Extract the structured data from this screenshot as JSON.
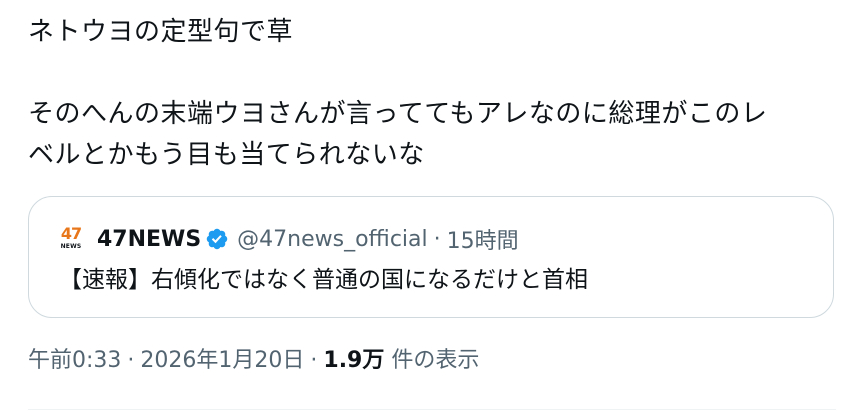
{
  "tweet": {
    "line1": "ネトウヨの定型句で草",
    "line2": "そのへんの末端ウヨさんが言っててもアレなのに総理がこのレ",
    "line3": "ベルとかもう目も当てられないな"
  },
  "quote": {
    "avatar_number": "47",
    "avatar_label": "NEWS",
    "author_name": "47NEWS",
    "author_handle": "@47news_official",
    "dot": "·",
    "time": "15時間",
    "text": "【速報】右傾化ではなく普通の国になるだけと首相"
  },
  "meta": {
    "time": "午前0:33",
    "sep1": "·",
    "date": "2026年1月20日",
    "sep2": "·",
    "views_count": "1.9万",
    "views_label": " 件の表示"
  },
  "colors": {
    "text": "#0f1419",
    "secondary": "#536471",
    "border": "#cfd9de",
    "verified": "#1d9bf0",
    "news_orange": "#e8771b"
  },
  "icons": {
    "verified": "verified-badge-icon",
    "avatar": "47news-logo"
  }
}
